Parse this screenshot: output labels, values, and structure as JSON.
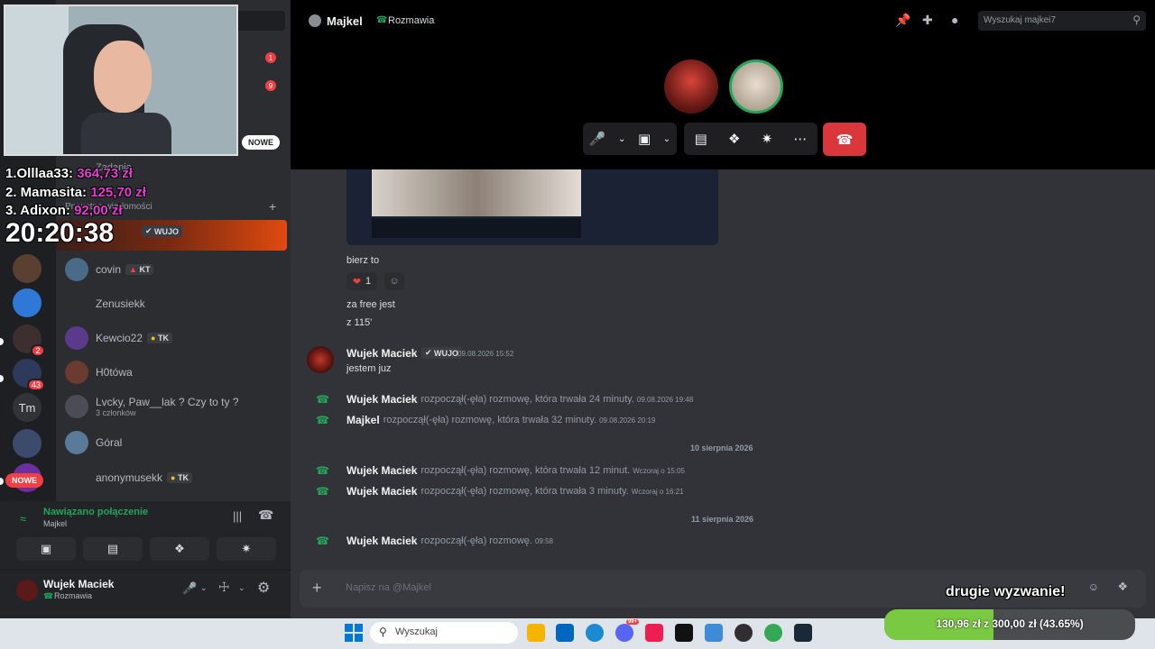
{
  "overlay": {
    "ranking": [
      {
        "label": "1.Olllaa33:",
        "amount": "364,73 zł"
      },
      {
        "label": "2. Mamasita:",
        "amount": "125,70 zł"
      },
      {
        "label": "3. Adixon:",
        "amount": "92,00 zł"
      }
    ],
    "clock": "20:20:38",
    "challenge": "drugie wyzwanie!",
    "goal": "130,96 zł z 300,00 zł (43.65%)",
    "goal_progress": 0.4365
  },
  "rail": {
    "badge1": "1",
    "badge2": "9",
    "new_top": "NOWE",
    "new_bottom": "NOWE",
    "badge_small1": "2",
    "badge_small2": "43",
    "tm_label": "Tm"
  },
  "dm_list": {
    "zadania_label": "Zadania",
    "header": "Prywatne wiadomości",
    "add_icon": "+",
    "active_tag": "WUJO",
    "items": [
      {
        "name": "covin",
        "tag": "KT",
        "sub": ""
      },
      {
        "name": "Zenusiekk",
        "tag": "",
        "sub": ""
      },
      {
        "name": "Kewcio22",
        "tag": "TK",
        "sub": ""
      },
      {
        "name": "H0tówa",
        "tag": "",
        "sub": ""
      },
      {
        "name": "Lvcky, Paw__lak ? Czy to ty ?",
        "tag": "",
        "sub": "3 członków"
      },
      {
        "name": "Góral",
        "tag": "",
        "sub": ""
      },
      {
        "name": "anonymusekk",
        "tag": "TK",
        "sub": ""
      }
    ]
  },
  "voice_panel": {
    "status": "Nawiązano połączenie",
    "channel": "Majkel"
  },
  "user_panel": {
    "name": "Wujek Maciek",
    "status": "Rozmawia"
  },
  "header": {
    "channel_name": "Majkel",
    "call_status": "Rozmawia",
    "search_placeholder": "Wyszukaj majkei7"
  },
  "chat": {
    "message1": "bierz to",
    "reaction_count": "1",
    "message2": "za free jest",
    "message3": "z 115'",
    "author": "Wujek Maciek",
    "author_tag": "WUJO",
    "author_time": "09.08.2026 15:52",
    "author_message": "jestem juz",
    "calls_a": [
      {
        "name": "Wujek Maciek",
        "text": "rozpoczął(-ęła) rozmowę, która trwała 24 minuty.",
        "time": "09.08.2026 19:48"
      },
      {
        "name": "Majkel",
        "text": "rozpoczął(-ęła) rozmowę, która trwała 32 minuty.",
        "time": "09.08.2026 20:19"
      }
    ],
    "divider1": "10 sierpnia 2026",
    "calls_b": [
      {
        "name": "Wujek Maciek",
        "text": "rozpoczął(-ęła) rozmowę, która trwała 12 minut.",
        "time": "Wczoraj o 15:05"
      },
      {
        "name": "Wujek Maciek",
        "text": "rozpoczął(-ęła) rozmowę, która trwała 3 minuty.",
        "time": "Wczoraj o 16:21"
      }
    ],
    "divider2": "11 sierpnia 2026",
    "calls_c": [
      {
        "name": "Wujek Maciek",
        "text": "rozpoczął(-ęła) rozmowę.",
        "time": "09:58"
      }
    ],
    "input_placeholder": "Napisz na @Majkel"
  },
  "taskbar": {
    "search_placeholder": "Wyszukaj",
    "discord_badge": "99+"
  },
  "colors": {
    "accent_green": "#23a55a",
    "hangup_red": "#da373c",
    "donation_pink": "#e83cd4"
  }
}
